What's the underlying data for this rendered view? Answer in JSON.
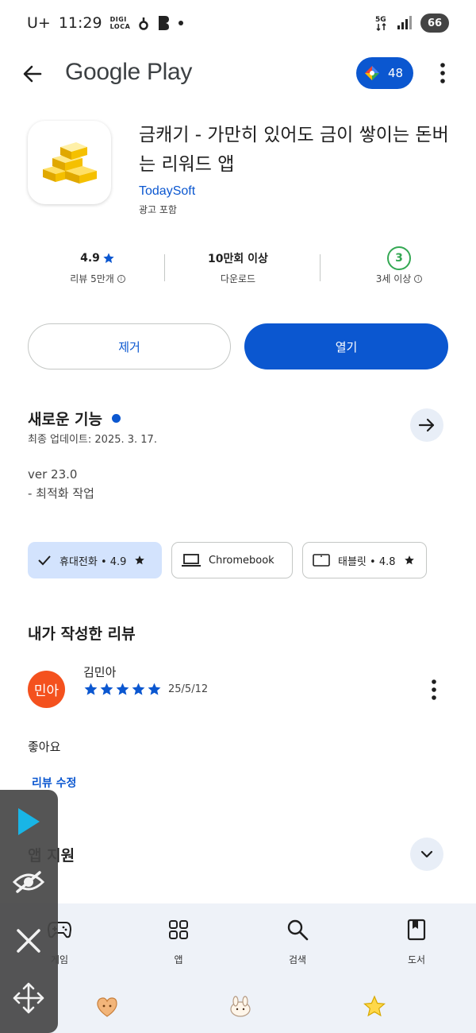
{
  "status_bar": {
    "time": "11:29",
    "carrier": "U+",
    "digi_label": "DIGI\nLOCA",
    "network": "5G",
    "battery": "66"
  },
  "app_bar": {
    "store_name": "Google Play",
    "points": "48"
  },
  "app": {
    "title": "금캐기 - 가만히 있어도 금이 쌓이는 돈버는 리워드 앱",
    "developer": "TodaySoft",
    "ads_notice": "광고 포함"
  },
  "stats": {
    "rating_value": "4.9",
    "rating_label": "리뷰 5만개",
    "downloads_value": "10만회 이상",
    "downloads_label": "다운로드",
    "age_value": "3",
    "age_label": "3세 이상"
  },
  "actions": {
    "uninstall": "제거",
    "open": "열기"
  },
  "whats_new": {
    "title": "새로운 기능",
    "updated": "최종 업데이트: 2025. 3. 17.",
    "line1": "ver 23.0",
    "line2": "- 최적화 작업"
  },
  "devices": {
    "phone": "휴대전화 • 4.9",
    "chromebook": "Chromebook",
    "tablet": "태블릿 • 4.8"
  },
  "my_review": {
    "heading": "내가 작성한 리뷰",
    "avatar_text": "민아",
    "author": "김민아",
    "stars": 5,
    "date": "25/5/12",
    "text": "좋아요",
    "edit_link": "리뷰 수정"
  },
  "app_support": {
    "title": "앱 지원"
  },
  "bottom_nav": {
    "games": "게임",
    "apps": "앱",
    "search": "검색",
    "books": "도서"
  },
  "colors": {
    "accent": "#0b57d0",
    "avatar": "#f4511e",
    "age_badge": "#34a853",
    "nav_bg": "#eef2f8"
  }
}
